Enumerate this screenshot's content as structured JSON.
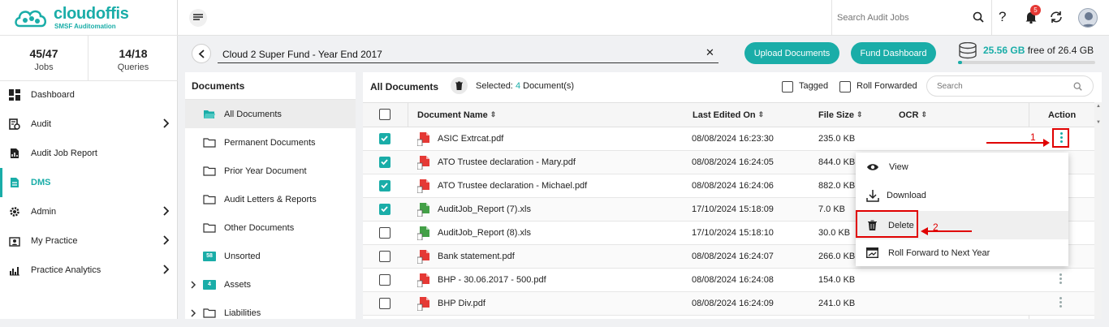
{
  "brand": {
    "name": "cloudoffis",
    "tagline": "SMSF Auditomation"
  },
  "stats": [
    {
      "value": "45/47",
      "label": "Jobs"
    },
    {
      "value": "14/18",
      "label": "Queries"
    }
  ],
  "nav": [
    {
      "label": "Dashboard",
      "icon": "dashboard-icon",
      "chevron": false,
      "active": false
    },
    {
      "label": "Audit",
      "icon": "audit-icon",
      "chevron": true,
      "active": false
    },
    {
      "label": "Audit Job Report",
      "icon": "report-icon",
      "chevron": false,
      "active": false
    },
    {
      "label": "DMS",
      "icon": "document-icon",
      "chevron": false,
      "active": true
    },
    {
      "label": "Admin",
      "icon": "gear-icon",
      "chevron": true,
      "active": false
    },
    {
      "label": "My Practice",
      "icon": "practice-icon",
      "chevron": true,
      "active": false
    },
    {
      "label": "Practice Analytics",
      "icon": "analytics-icon",
      "chevron": true,
      "active": false
    }
  ],
  "topbar": {
    "search_placeholder": "Search Audit Jobs",
    "notification_count": "5"
  },
  "fund": {
    "name": "Cloud 2 Super Fund - Year End 2017",
    "upload_label": "Upload Documents",
    "dashboard_label": "Fund Dashboard"
  },
  "storage": {
    "used": "25.56 GB",
    "rest": "free of 26.4 GB",
    "fraction_used": 0.03
  },
  "folders_panel": {
    "title": "Documents",
    "items": [
      {
        "label": "All Documents",
        "icon": "folder-open-icon",
        "selected": true,
        "expander": false,
        "badge": ""
      },
      {
        "label": "Permanent Documents",
        "icon": "folder-icon",
        "selected": false,
        "expander": false,
        "badge": ""
      },
      {
        "label": "Prior Year Document",
        "icon": "folder-icon",
        "selected": false,
        "expander": false,
        "badge": ""
      },
      {
        "label": "Audit Letters & Reports",
        "icon": "folder-icon",
        "selected": false,
        "expander": false,
        "badge": ""
      },
      {
        "label": "Other Documents",
        "icon": "folder-icon",
        "selected": false,
        "expander": false,
        "badge": ""
      },
      {
        "label": "Unsorted",
        "icon": "folder-count-icon",
        "selected": false,
        "expander": false,
        "badge": "58"
      },
      {
        "label": "Assets",
        "icon": "folder-count-icon",
        "selected": false,
        "expander": true,
        "badge": "4"
      },
      {
        "label": "Liabilities",
        "icon": "folder-icon",
        "selected": false,
        "expander": true,
        "badge": ""
      }
    ]
  },
  "documents": {
    "title": "All Documents",
    "selected_prefix": "Selected:",
    "selected_count": "4",
    "selected_suffix": "Document(s)",
    "filter_tagged": "Tagged",
    "filter_rolled": "Roll Forwarded",
    "search_placeholder": "Search",
    "columns": {
      "name": "Document Name",
      "edited": "Last Edited On",
      "size": "File Size",
      "ocr": "OCR",
      "action": "Action"
    },
    "rows": [
      {
        "name": "ASIC Extrcat.pdf",
        "type": "pdf",
        "edited": "08/08/2024 16:23:30",
        "size": "235.0 KB",
        "checked": true
      },
      {
        "name": "ATO Trustee declaration - Mary.pdf",
        "type": "pdf",
        "edited": "08/08/2024 16:24:05",
        "size": "844.0 KB",
        "checked": true
      },
      {
        "name": "ATO Trustee declaration - Michael.pdf",
        "type": "pdf",
        "edited": "08/08/2024 16:24:06",
        "size": "882.0 KB",
        "checked": true
      },
      {
        "name": "AuditJob_Report (7).xls",
        "type": "xls",
        "edited": "17/10/2024 15:18:09",
        "size": "7.0 KB",
        "checked": true
      },
      {
        "name": "AuditJob_Report (8).xls",
        "type": "xls",
        "edited": "17/10/2024 15:18:10",
        "size": "30.0 KB",
        "checked": false
      },
      {
        "name": "Bank statement.pdf",
        "type": "pdf",
        "edited": "08/08/2024 16:24:07",
        "size": "266.0 KB",
        "checked": false
      },
      {
        "name": "BHP - 30.06.2017 - 500.pdf",
        "type": "pdf",
        "edited": "08/08/2024 16:24:08",
        "size": "154.0 KB",
        "checked": false
      },
      {
        "name": "BHP Div.pdf",
        "type": "pdf",
        "edited": "08/08/2024 16:24:09",
        "size": "241.0 KB",
        "checked": false
      }
    ]
  },
  "action_menu": {
    "items": [
      {
        "label": "View",
        "icon": "eye-icon"
      },
      {
        "label": "Download",
        "icon": "download-icon"
      },
      {
        "label": "Delete",
        "icon": "trash-icon"
      },
      {
        "label": "Roll Forward to Next Year",
        "icon": "roll-forward-icon"
      }
    ]
  },
  "annotations": {
    "step1": "1",
    "step2": "2"
  },
  "colors": {
    "accent": "#1aada8",
    "annotation": "#e00000",
    "pdf": "#e53935",
    "xls": "#43a047"
  }
}
